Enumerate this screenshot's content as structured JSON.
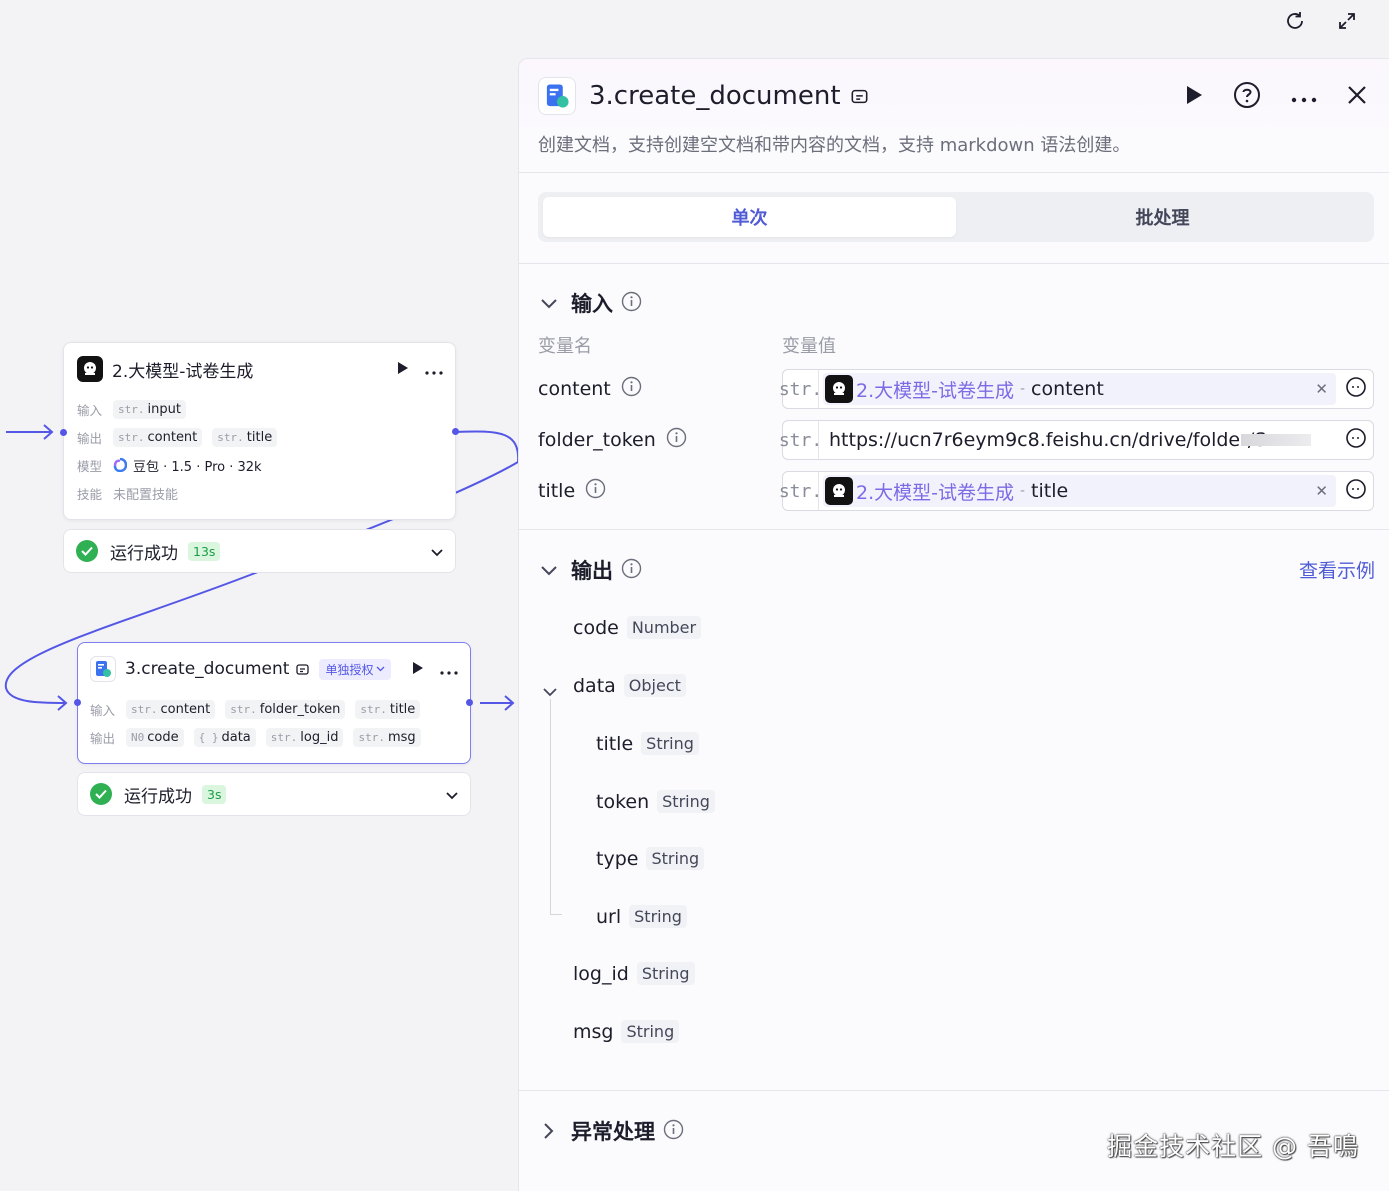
{
  "canvas": {
    "toolbar": {
      "refresh_icon": "refresh-icon",
      "fullscreen_icon": "expand-icon"
    },
    "node_llm": {
      "title": "2.大模型-试卷生成",
      "input_label": "输入",
      "input_tags": [
        {
          "type": "str.",
          "name": "input"
        }
      ],
      "output_label": "输出",
      "output_tags": [
        {
          "type": "str.",
          "name": "content"
        },
        {
          "type": "str.",
          "name": "title"
        }
      ],
      "model_label": "模型",
      "model_value": "豆包 · 1.5 · Pro · 32k",
      "skill_label": "技能",
      "skill_value": "未配置技能",
      "status": "运行成功",
      "time": "13s"
    },
    "node_doc": {
      "title": "3.create_document",
      "auth_badge": "单独授权",
      "input_label": "输入",
      "input_tags": [
        {
          "type": "str.",
          "name": "content"
        },
        {
          "type": "str.",
          "name": "folder_token"
        },
        {
          "type": "str.",
          "name": "title"
        }
      ],
      "output_label": "输出",
      "output_tags": [
        {
          "type": "N0",
          "name": "code"
        },
        {
          "type": "{ }",
          "name": "data"
        },
        {
          "type": "str.",
          "name": "log_id"
        },
        {
          "type": "str.",
          "name": "msg"
        }
      ],
      "status": "运行成功",
      "time": "3s"
    }
  },
  "panel": {
    "title": "3.create_document",
    "description": "创建文档，支持创建空文档和带内容的文档，支持 markdown 语法创建。",
    "tabs": [
      {
        "label": "单次",
        "active": true
      },
      {
        "label": "批处理",
        "active": false
      }
    ],
    "input": {
      "title": "输入",
      "col_name": "变量名",
      "col_value": "变量值",
      "params": [
        {
          "name": "content",
          "type": "str.",
          "ref_node": "2.大模型-试卷生成",
          "ref_sep": "-",
          "ref_var": "content"
        },
        {
          "name": "folder_token",
          "type": "str.",
          "value": "https://ucn7r6eym9c8.feishu.cn/drive/folder/S"
        },
        {
          "name": "title",
          "type": "str.",
          "ref_node": "2.大模型-试卷生成",
          "ref_sep": "-",
          "ref_var": "title"
        }
      ]
    },
    "output": {
      "title": "输出",
      "see_example": "查看示例",
      "fields": [
        {
          "name": "code",
          "type": "Number"
        },
        {
          "name": "data",
          "type": "Object"
        },
        {
          "name": "title",
          "type": "String"
        },
        {
          "name": "token",
          "type": "String"
        },
        {
          "name": "type",
          "type": "String"
        },
        {
          "name": "url",
          "type": "String"
        },
        {
          "name": "log_id",
          "type": "String"
        },
        {
          "name": "msg",
          "type": "String"
        }
      ]
    },
    "error": {
      "title": "异常处理"
    }
  },
  "watermark": "掘金技术社区 @ 吾鳴",
  "colors": {
    "accent": "#5457e6",
    "link": "#4f5cd6",
    "success": "#2fb053",
    "ref_node": "#7d6ae6"
  }
}
